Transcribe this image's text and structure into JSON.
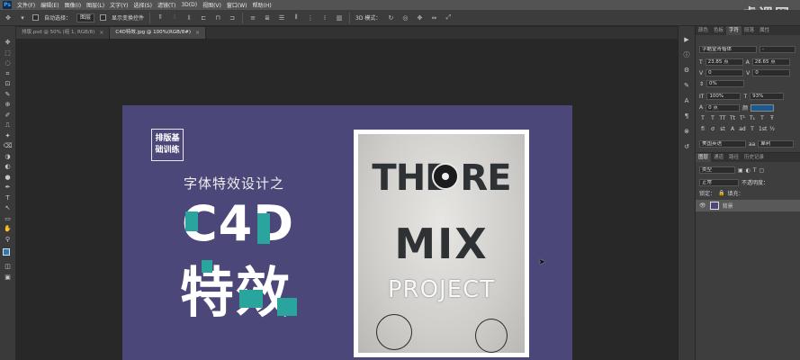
{
  "menubar": {
    "logo": "Ps",
    "items": [
      "文件(F)",
      "编辑(E)",
      "图像(I)",
      "图层(L)",
      "文字(Y)",
      "选择(S)",
      "滤镜(T)",
      "3D(D)",
      "视图(V)",
      "窗口(W)",
      "帮助(H)"
    ],
    "watermark": "虎课网"
  },
  "optionsbar": {
    "auto_select_label": "自动选择：",
    "auto_select_value": "图层",
    "show_transform_label": "显示变换控件",
    "mode_3d_label": "3D 模式："
  },
  "tabs": [
    {
      "label": "排版.psd @ 50% (组 1, RGB/8)",
      "active": false
    },
    {
      "label": "C4D特效.jpg @ 100%(RGB/8#)",
      "active": true
    }
  ],
  "tools": [
    "✥",
    "⬚",
    "◌",
    "⌗",
    "⊡",
    "✎",
    "⊕",
    "✐",
    "⎍",
    "✦",
    "⌫",
    "◑",
    "◐",
    "●",
    "✒",
    "T",
    "↖",
    "▭",
    "✋",
    "⚲"
  ],
  "artwork": {
    "tag_line1": "排版基",
    "tag_line2": "础训练",
    "subtitle": "字体特效设计之",
    "headline_en": "C4D",
    "headline_zh": "特效",
    "background_color": "#4b4879",
    "accent_color": "#2aa59e"
  },
  "poster": {
    "line1": "THE RE",
    "line2": "MIX",
    "line3": "PROJECT"
  },
  "panel": {
    "tabs": [
      "颜色",
      "色板",
      "字符",
      "段落",
      "属性"
    ],
    "active_tab": "字符",
    "font_family": "字酷堂青楷体",
    "font_style": "-",
    "font_size": "23.85 点",
    "leading": "28.65 点",
    "kerning": "0",
    "tracking": "0",
    "baseline_percent": "0%",
    "vertical_scale": "100%",
    "horizontal_scale": "93%",
    "baseline_shift": "0 点",
    "language": "美国英语",
    "antialias": "犀利",
    "color": "#1a5a91"
  },
  "layers": {
    "tabs": [
      "图层",
      "通道",
      "路径",
      "历史记录"
    ],
    "kind_label": "类型",
    "mode_label": "正常",
    "opacity_label": "不透明度：",
    "lock_label": "锁定：",
    "fill_label": "填充：",
    "layer_name": "背景"
  }
}
